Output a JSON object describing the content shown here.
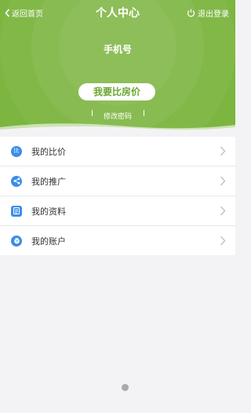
{
  "header": {
    "back_label": "返回首页",
    "title": "个人中心",
    "logout_label": "退出登录",
    "phone_label": "手机号",
    "compare_button": "我要比房价",
    "change_password": "修改密码"
  },
  "menu": {
    "items": [
      {
        "label": "我的比价",
        "icon": "compare-icon",
        "icon_text": "比"
      },
      {
        "label": "我的推广",
        "icon": "share-icon"
      },
      {
        "label": "我的资料",
        "icon": "profile-doc-icon"
      },
      {
        "label": "我的账户",
        "icon": "account-icon"
      }
    ]
  },
  "colors": {
    "header_bg": "#7cb53f",
    "accent_green": "#6aa631",
    "icon_blue": "#3d8de8",
    "page_bg": "#f3f3f5"
  }
}
